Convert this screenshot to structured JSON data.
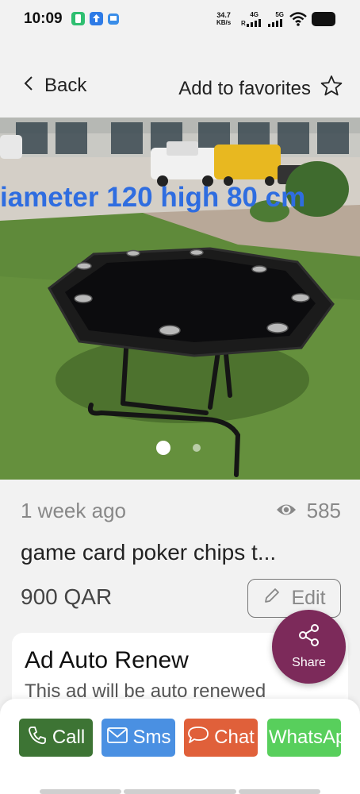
{
  "status_bar": {
    "time": "10:09",
    "net_speed_value": "34.7",
    "net_speed_unit": "KB/s",
    "signal_1_label": "4G",
    "signal_2_label": "5G"
  },
  "header": {
    "back_label": "Back",
    "favorites_label": "Add to favorites"
  },
  "gallery": {
    "overlay_text": "iameter 120 high 80 cm",
    "image_count": 2,
    "active_index": 0
  },
  "listing": {
    "posted": "1 week ago",
    "views": "585",
    "title": "game card poker chips t...",
    "price": "900 QAR",
    "edit_label": "Edit"
  },
  "renew_card": {
    "title": "Ad Auto Renew",
    "description": "This ad will be auto renewed"
  },
  "share": {
    "label": "Share"
  },
  "actions": {
    "call": "Call",
    "sms": "Sms",
    "chat": "Chat",
    "whatsapp": "WhatsApp"
  },
  "colors": {
    "call": "#3d7434",
    "sms": "#4a90e2",
    "chat": "#e0603a",
    "whatsapp": "#58cf5c",
    "share": "#7c2a5a",
    "overlay_text": "#2f6de0"
  }
}
